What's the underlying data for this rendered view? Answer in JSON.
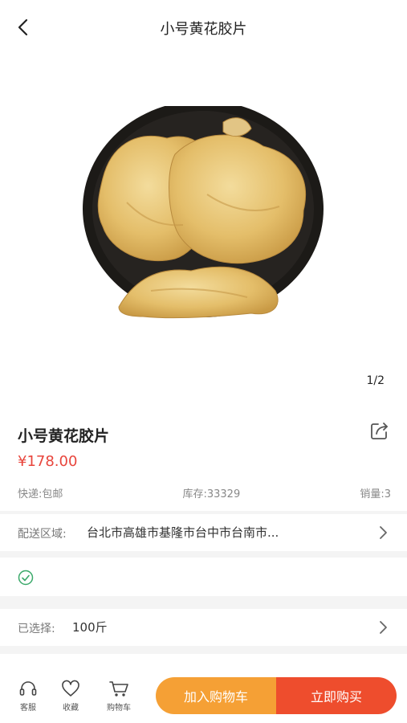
{
  "header": {
    "title": "小号黄花胶片"
  },
  "gallery": {
    "pager": "1/2"
  },
  "product": {
    "name": "小号黄花胶片",
    "price": "¥178.00",
    "shipping": "快递:包邮",
    "stock": "库存:33329",
    "sales": "销量:3"
  },
  "delivery": {
    "label": "配送区域:",
    "value": "台北市高雄市基隆市台中市台南市..."
  },
  "selection": {
    "label": "已选择:",
    "value": "100斤"
  },
  "bottom": {
    "tabs": [
      {
        "label": "客服",
        "icon": "headset-icon"
      },
      {
        "label": "收藏",
        "icon": "heart-icon"
      },
      {
        "label": "购物车",
        "icon": "cart-icon"
      }
    ],
    "add_to_cart": "加入购物车",
    "buy_now": "立即购买"
  },
  "colors": {
    "price": "#e8453c",
    "cart_button": "#f5a035",
    "buy_button": "#ee4d2d",
    "check": "#3aa96a"
  }
}
